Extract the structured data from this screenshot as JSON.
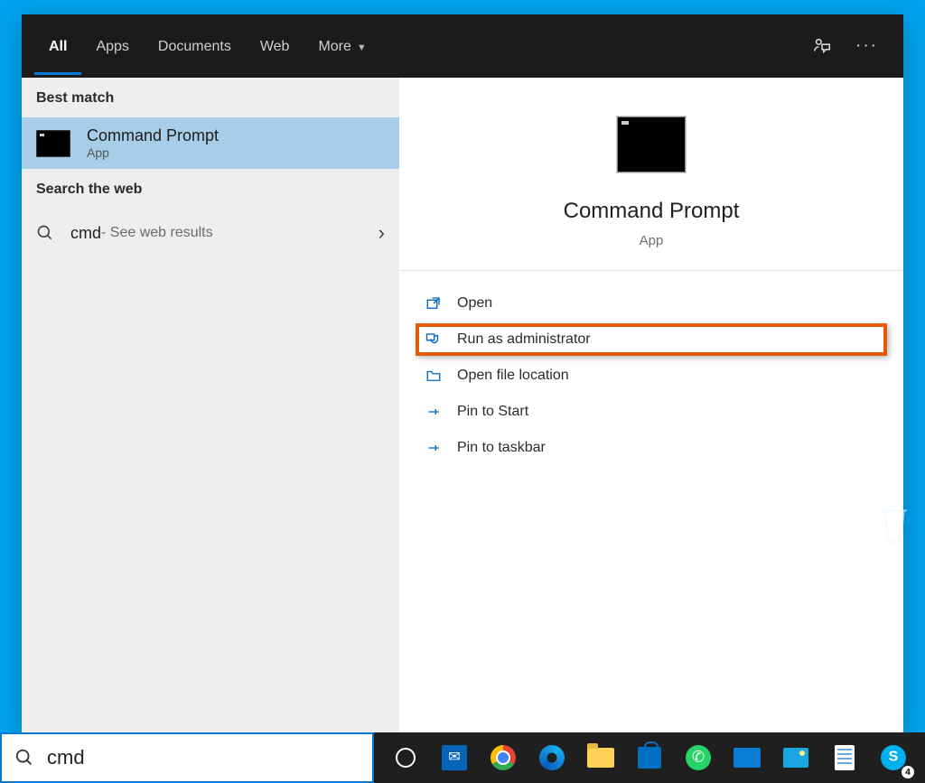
{
  "tabs": {
    "all": "All",
    "apps": "Apps",
    "documents": "Documents",
    "web": "Web",
    "more": "More"
  },
  "left": {
    "best_match": "Best match",
    "search_web": "Search the web",
    "result": {
      "title": "Command Prompt",
      "subtitle": "App"
    },
    "web": {
      "term": "cmd",
      "suffix": " - See web results"
    }
  },
  "preview": {
    "title": "Command Prompt",
    "subtitle": "App"
  },
  "actions": {
    "open": "Open",
    "run_admin": "Run as administrator",
    "open_file_loc": "Open file location",
    "pin_start": "Pin to Start",
    "pin_taskbar": "Pin to taskbar"
  },
  "search_value": "cmd",
  "skype_badge": "4"
}
